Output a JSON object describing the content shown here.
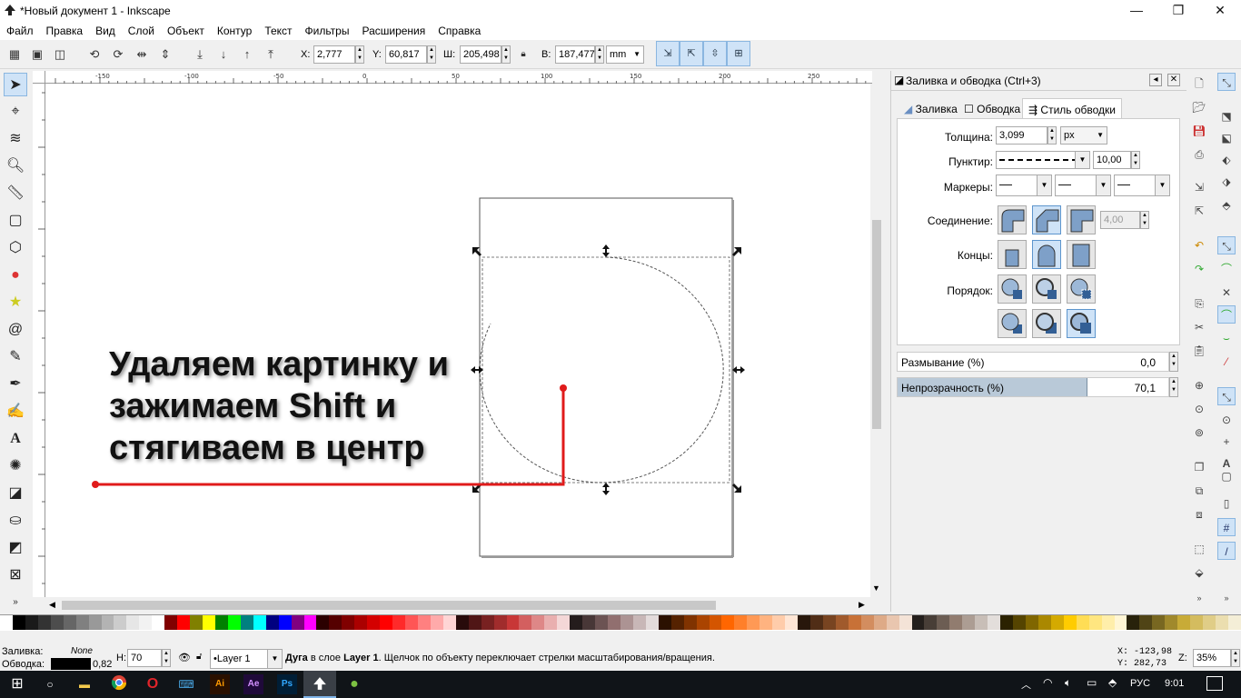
{
  "window": {
    "title": "*Новый документ 1 - Inkscape",
    "minimize": "—",
    "maximize": "❐",
    "close": "✕"
  },
  "menu": [
    "Файл",
    "Правка",
    "Вид",
    "Слой",
    "Объект",
    "Контур",
    "Текст",
    "Фильтры",
    "Расширения",
    "Справка"
  ],
  "toolbar": {
    "x_label": "X:",
    "x_value": "2,777",
    "y_label": "Y:",
    "y_value": "60,817",
    "w_label": "Ш:",
    "w_value": "205,498",
    "h_label": "В:",
    "h_value": "187,477",
    "unit": "mm"
  },
  "ruler_h_labels": [
    "-150",
    "-100",
    "-50",
    "0",
    "50",
    "100",
    "150",
    "200",
    "250",
    "300"
  ],
  "panel": {
    "title": "Заливка и обводка (Ctrl+3)",
    "tabs": [
      "Заливка",
      "Обводка",
      "Стиль обводки"
    ],
    "width_label": "Толщина:",
    "width_value": "3,099",
    "width_unit": "px",
    "dash_label": "Пунктир:",
    "dash_value": "10,00",
    "markers_label": "Маркеры:",
    "join_label": "Соединение:",
    "miter_value": "4,00",
    "caps_label": "Концы:",
    "order_label": "Порядок:",
    "blur_label": "Размывание (%)",
    "blur_value": "0,0",
    "opacity_label": "Непрозрачность (%)",
    "opacity_value": "70,1",
    "opacity_fraction": 0.701
  },
  "annotation": {
    "line1": "Удаляем картинку и",
    "line2": "зажимаем Shift и",
    "line3": "стягиваем в центр"
  },
  "status": {
    "fill_label": "Заливка:",
    "fill_value": "None",
    "stroke_label": "Обводка:",
    "stroke_width": "0,82",
    "h_label": "H:",
    "h_value": "70",
    "layer": "•Layer 1",
    "message_bold1": "Дуга",
    "message_mid": " в слое ",
    "message_bold2": "Layer 1",
    "message_rest": ". Щелчок по объекту переключает стрелки масштабирования/вращения.",
    "coord_x": "X: -123,98",
    "coord_y": "Y: 282,73",
    "zoom_label": "Z:",
    "zoom_value": "35%"
  },
  "taskbar": {
    "lang": "РУС",
    "time": "9:01"
  },
  "colors": {
    "accent_red": "#e01b1b",
    "selection_blue": "#cfe3f7"
  }
}
